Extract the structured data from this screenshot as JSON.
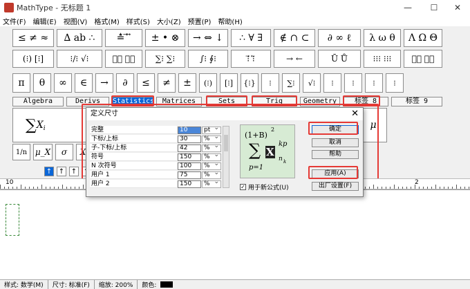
{
  "window": {
    "title": "MathType - 无标题 1",
    "minimize": "—",
    "maximize": "☐",
    "close": "✕"
  },
  "menu": [
    "文件(F)",
    "编辑(E)",
    "视图(V)",
    "格式(M)",
    "样式(S)",
    "大小(Z)",
    "预置(P)",
    "帮助(H)"
  ],
  "palette_row1": [
    "≤ ≠ ≈",
    "∆ ab ∴",
    "≛ ⃗ ⃡",
    "± • ⊗",
    "→ ⇔ ↓",
    "∴ ∀ ∃",
    "∉ ∩ ⊂",
    "∂ ∞ ℓ",
    "λ ω θ",
    "Λ Ω Θ"
  ],
  "palette_row2": [
    "(⁝) [⁝]",
    "⁝∕⁝ √⁝",
    "⁝⃞ ⁝⃞",
    "∑⁝ ∑⁝",
    "∫⁝ ∮⁝",
    "⁝⃗ ⁝⃖",
    "→ ←",
    "Ū Ů",
    "⁝⁝⁝ ⁝⁝⁝",
    "⁝⃞ ⁝⃞"
  ],
  "symbol_row": [
    "π",
    "θ",
    "∞",
    "∈",
    "→",
    "∂",
    "≤",
    "≠",
    "±",
    "(⁝)",
    "[⁝]",
    "{⁝}",
    "⁝",
    "∑⁝",
    "√⁝",
    "⁝",
    "⁝",
    "⁝",
    "⁝"
  ],
  "tabs": [
    "Algebra",
    "Derivs",
    "Statistics",
    "Matrices",
    "Sets",
    "Trig",
    "Geometry",
    "标签 8",
    "标签 9"
  ],
  "template_preview_labels": [
    "μ",
    "σ",
    "X",
    "1/n",
    "μ_X"
  ],
  "nav_buttons": [
    "↑",
    "↑",
    "↑",
    "↑"
  ],
  "ruler_numbers": [
    "10",
    "1",
    "2"
  ],
  "dialog": {
    "title": "定义尺寸",
    "close": "✕",
    "rows": [
      {
        "label": "完整",
        "value": "10",
        "unit": "pt"
      },
      {
        "label": "下标/上标",
        "value": "30",
        "unit": "%"
      },
      {
        "label": "子-下标/上标",
        "value": "42",
        "unit": "%"
      },
      {
        "label": "符号",
        "value": "150",
        "unit": "%"
      },
      {
        "label": "N 次符号",
        "value": "100",
        "unit": "%"
      },
      {
        "label": "用户 1",
        "value": "75",
        "unit": "%"
      },
      {
        "label": "用户 2",
        "value": "150",
        "unit": "%"
      }
    ],
    "buttons": {
      "ok": "确定",
      "cancel": "取消",
      "help": "帮助",
      "apply": "应用(A)",
      "factory": "出厂设置(F)"
    },
    "checkbox_label": "用于新公式(U)",
    "checkbox_checked": true,
    "preview": {
      "top": "(1+B)",
      "exp": "2",
      "sigma": "∑",
      "var": "X",
      "sup": "kp",
      "sub": "n",
      "subsub": "k",
      "lower": "p=1"
    }
  },
  "status": {
    "style": "样式: 数学(M)",
    "size": "尺寸: 标准(F)",
    "zoom": "缩放: 200%",
    "color": "颜色:"
  },
  "colors": {
    "accent": "#0a66d8",
    "highlight": "#e53935",
    "preview_bg": "#d7ebd4"
  }
}
